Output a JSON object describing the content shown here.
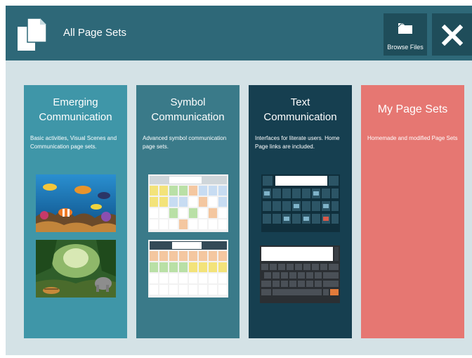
{
  "header": {
    "title": "All Page Sets",
    "browse_label": "Browse Files"
  },
  "cards": [
    {
      "title": "Emerging Communication",
      "description": "Basic activities, Visual Scenes and Communication page sets."
    },
    {
      "title": "Symbol Communication",
      "description": "Advanced symbol communication page sets."
    },
    {
      "title": "Text Communication",
      "description": "Interfaces for literate users. Home Page links are included."
    },
    {
      "title": "My Page Sets",
      "description": "Homemade and modified Page Sets"
    }
  ],
  "colors": {
    "header": "#2e6878",
    "background": "#d4e2e6",
    "emerging": "#3f96a8",
    "symbol": "#3a7a89",
    "text": "#163f50",
    "my_page_sets": "#e67772"
  },
  "icons": [
    "page-sets-icon",
    "folder-icon",
    "close-icon"
  ]
}
